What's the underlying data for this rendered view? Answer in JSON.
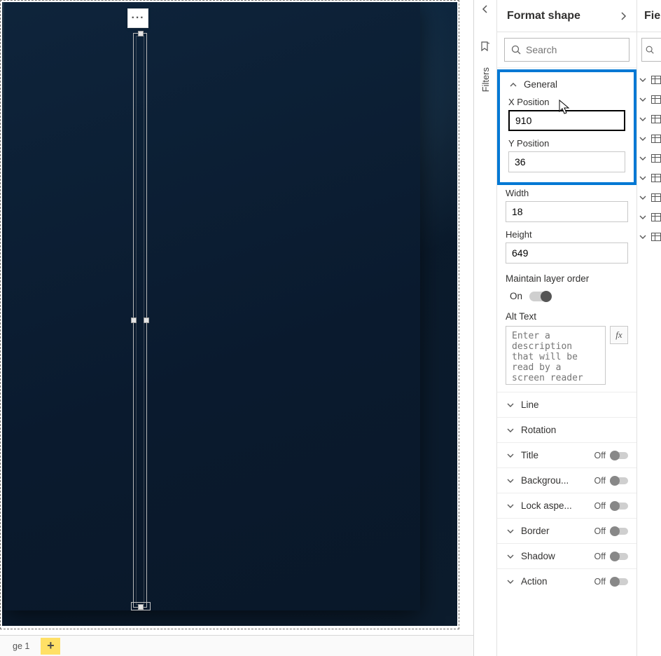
{
  "canvas": {
    "page_tab_label": "ge 1",
    "more_glyph": "···"
  },
  "filters_gutter": {
    "label": "Filters"
  },
  "format_pane": {
    "title": "Format shape",
    "search_placeholder": "Search",
    "general": {
      "label": "General",
      "x_label": "X Position",
      "x_value": "910",
      "y_label": "Y Position",
      "y_value": "36",
      "width_label": "Width",
      "width_value": "18",
      "height_label": "Height",
      "height_value": "649",
      "maintain_label": "Maintain layer order",
      "maintain_state_label": "On",
      "alt_label": "Alt Text",
      "alt_placeholder": "Enter a description that will be read by a screen reader on selecting the visual.",
      "fx_label": "fx"
    },
    "sections": {
      "line": "Line",
      "rotation": "Rotation",
      "title": "Title",
      "background": "Backgrou...",
      "lock_aspect": "Lock aspe...",
      "border": "Border",
      "shadow": "Shadow",
      "action": "Action",
      "off_label": "Off"
    }
  },
  "fields_pane": {
    "title": "Fie"
  }
}
